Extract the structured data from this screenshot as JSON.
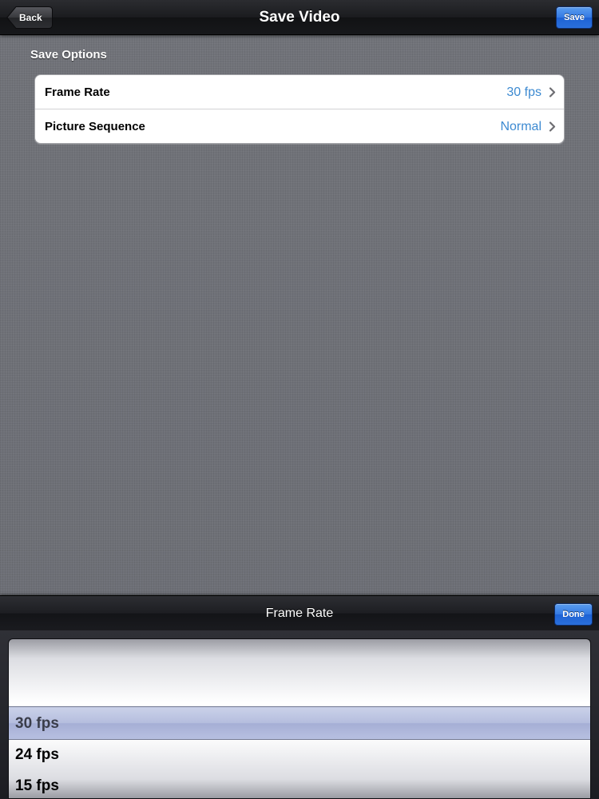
{
  "navbar": {
    "title": "Save Video",
    "back_label": "Back",
    "save_label": "Save"
  },
  "section": {
    "header": "Save Options"
  },
  "options": [
    {
      "label": "Frame Rate",
      "value": "30 fps"
    },
    {
      "label": "Picture Sequence",
      "value": "Normal"
    }
  ],
  "picker": {
    "title": "Frame Rate",
    "done_label": "Done",
    "items": [
      "30 fps",
      "24 fps",
      "15 fps"
    ],
    "selected": "30 fps"
  },
  "icons": {
    "back": "back-arrow-icon",
    "disclosure": "chevron-right-icon"
  },
  "colors": {
    "accent_blue": "#3479e3",
    "value_blue": "#3d8ad1",
    "background": "#6f7178"
  }
}
